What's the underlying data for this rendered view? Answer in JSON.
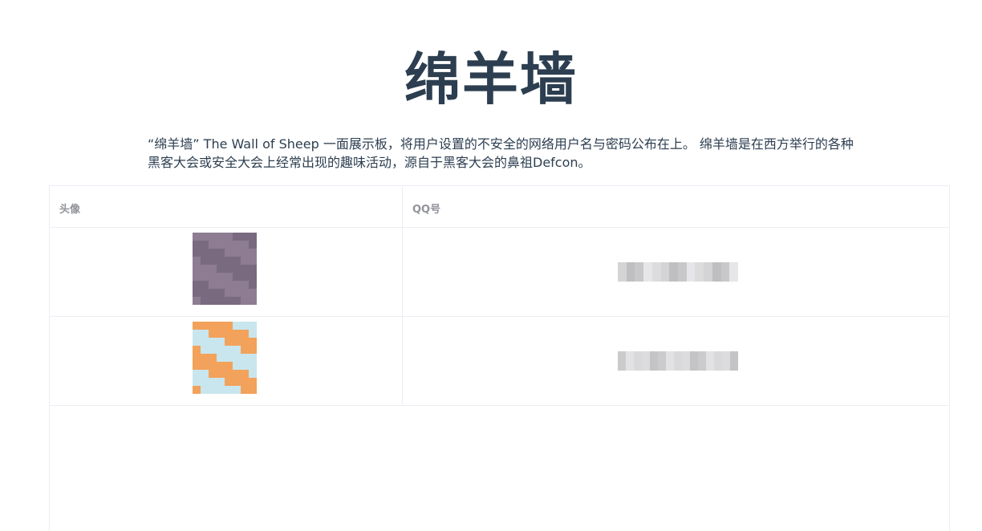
{
  "page": {
    "title": "绵羊墙",
    "description": "“绵羊墙” The Wall of Sheep 一面展示板，将用户设置的不安全的网络用户名与密码公布在上。 绵羊墙是在西方举行的各种黑客大会或安全大会上经常出现的趣味活动，源自于黑客大会的鼻祖Defcon。"
  },
  "table": {
    "headers": [
      "头像",
      "QQ号"
    ],
    "rows": [
      {
        "avatar": "pixelated-avatar-1",
        "qq": ""
      },
      {
        "avatar": "pixelated-avatar-2",
        "qq": ""
      }
    ]
  },
  "colors": {
    "title": "#2c3e50",
    "text": "#2c3e50",
    "header_text": "#909399",
    "border": "#ebeef5"
  }
}
